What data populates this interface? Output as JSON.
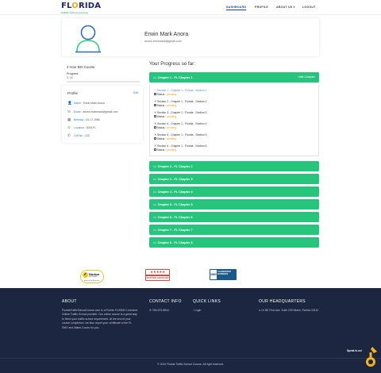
{
  "brand": {
    "name_left": "FL",
    "name_o": "O",
    "name_right": "RIDA",
    "tagline": "traffic school course"
  },
  "nav": {
    "items": [
      "DASHBOARD",
      "PROFILE",
      "ABOUT US",
      "LOGOUT"
    ]
  },
  "user": {
    "name": "Erwin Mark Anora",
    "email": "anora.erwinmark@gmail.com"
  },
  "course": {
    "title": "4 Hour BDI Course:",
    "progress_label": "Progress",
    "progress_value": "0 / 40",
    "progress_fraction": 0.0
  },
  "profile_panel": {
    "title": "Profile",
    "edit": "Edit",
    "rows": [
      {
        "icon": "person-icon",
        "key": "Name :",
        "value": "Erwin Mark Anora"
      },
      {
        "icon": "envelope-icon",
        "key": "Email :",
        "value": "anora.erwinmark@gmail.com"
      },
      {
        "icon": "calendar-icon",
        "key": "Birthday :",
        "value": "04-17-1986"
      },
      {
        "icon": "location-icon",
        "key": "Location :",
        "value": "3000 FL"
      },
      {
        "icon": "phone-icon",
        "key": "Cell No :",
        "value": "123"
      }
    ]
  },
  "progress": {
    "title": "Your Progress so far:",
    "view_label": "Visit Chapter",
    "chapter1": "Chapter 1 - FL Chapter 1",
    "sections": [
      {
        "title": "Section 1 - Chapter 1 - Florida - Section 1",
        "status_label": "Status :",
        "status": "pending"
      },
      {
        "title": "Section 2 - Chapter 1 - Florida - Section 2",
        "status_label": "Status :",
        "status": "pending"
      },
      {
        "title": "Section 3 - Chapter 1 - Florida - Section 3",
        "status_label": "Status :",
        "status": "pending"
      },
      {
        "title": "Section 4 - Chapter 1 - Florida - Section 4",
        "status_label": "Status :",
        "status": "pending"
      },
      {
        "title": "Section 5 - Chapter 1 - Florida - Section 5",
        "status_label": "Status :",
        "status": "pending"
      },
      {
        "title": "Section 6 - Chapter 1 - Florida - Section 6",
        "status_label": "Status :",
        "status": "pending"
      }
    ],
    "chapters": [
      "Chapter 2 - FL Chapter 2",
      "Chapter 3 - FL Chapter 3",
      "Chapter 4 - FL Chapter 4",
      "Chapter 5 - FL Chapter 5",
      "Chapter 6 - FL Chapter 6",
      "Chapter 7 - FL Chapter 7",
      "Chapter 8 - FL Chapter 8"
    ]
  },
  "badges": {
    "norton": {
      "title": "Norton",
      "line2": "SECURED",
      "line3": "powered by Symantec"
    },
    "stars": {
      "stars": "★★★★★",
      "label": "SHOPPER APPROVED"
    },
    "bbb": {
      "mark": "BBB",
      "line1": "ACCREDITED",
      "line2": "BUSINESS"
    }
  },
  "footer": {
    "about_title": "ABOUT",
    "about_text": "FloridaTrafficSchoolCourse.com is a Florida FLHSMV Licensed Online Traffic School provider. Our online course is a great way to finish your traffic school requirement. At the end of your course completion, we also report your certificate to the FL DMV and Miami Courts for you.",
    "contact_title": "CONTACT INFO",
    "contact_phone": "786-673-8844",
    "links_title": "QUICK LINKS",
    "links": [
      "Login"
    ],
    "hq_title": "OUR HEADQUARTERS",
    "hq_address": "14 NE First Ave. Suite 200 Miami, Florida 33132",
    "copyright": "© 2024 Florida Traffic School Course. All right reserved.",
    "speak": "Speak to us!"
  },
  "colors": {
    "accent_green": "#27c47d",
    "nav_blue": "#1f3fa8",
    "footer_bg": "#1c2640",
    "pending": "#f0a020"
  }
}
